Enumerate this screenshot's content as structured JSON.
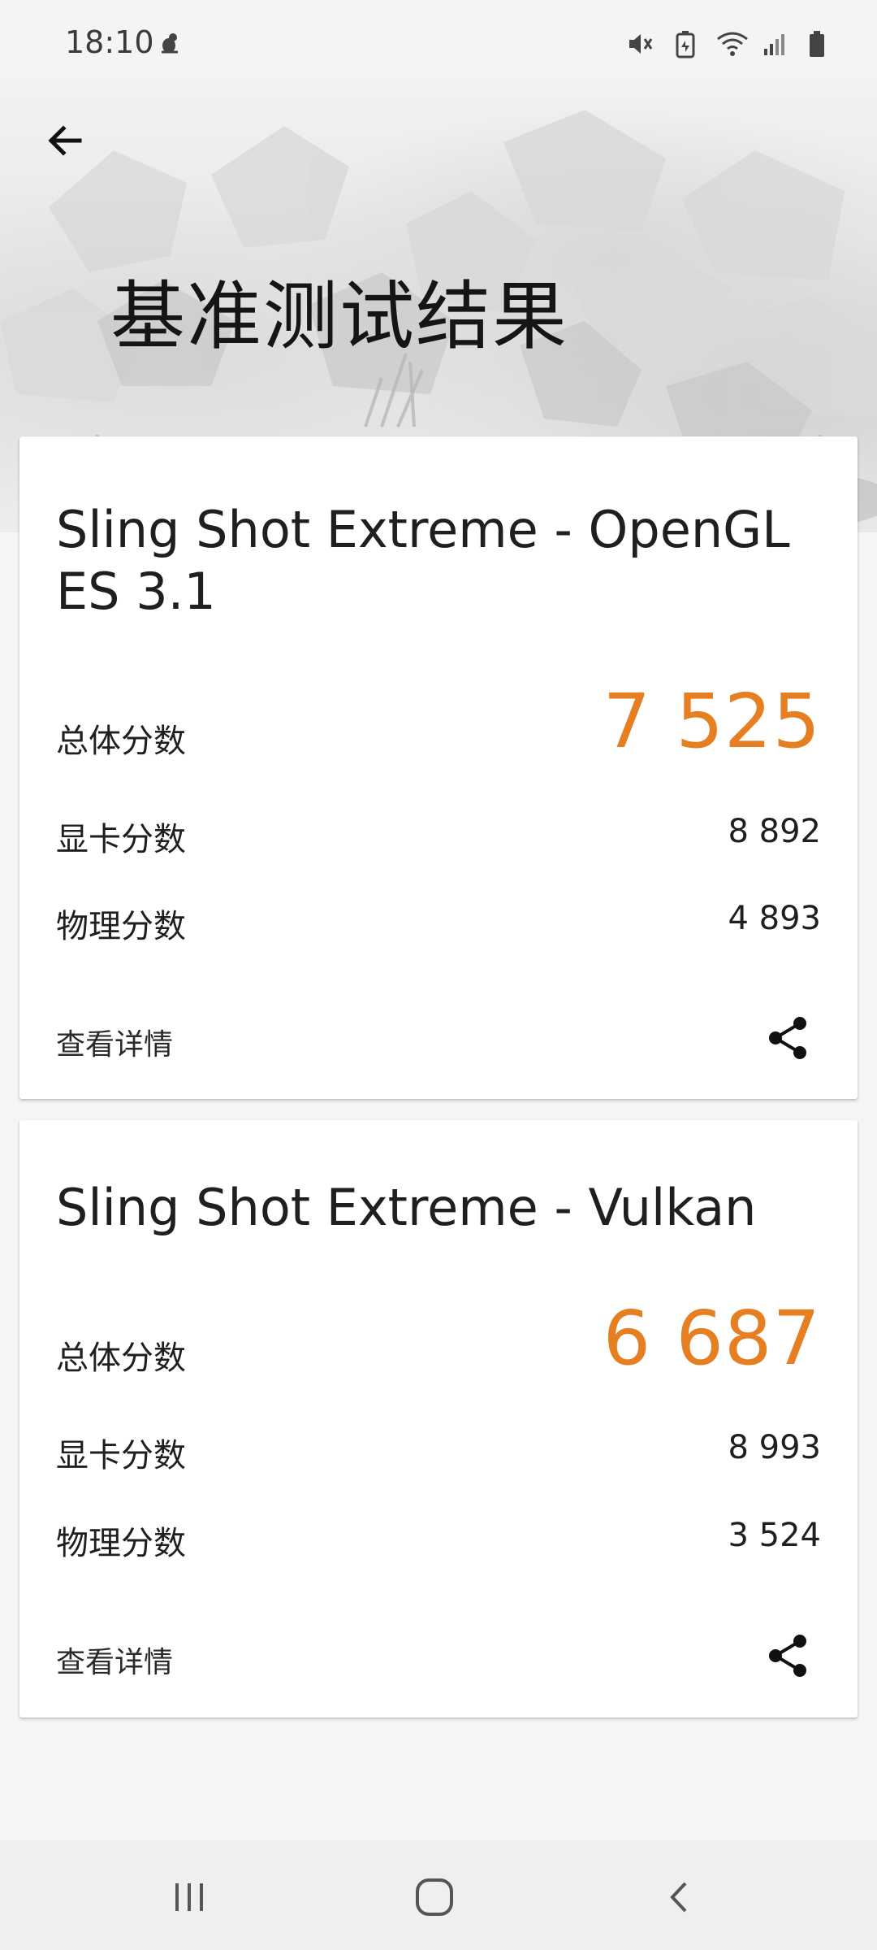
{
  "status_bar": {
    "time": "18:10",
    "icons": [
      "mute-icon",
      "battery-saver-icon",
      "wifi-icon",
      "signal-icon",
      "battery-icon"
    ]
  },
  "header": {
    "title": "基准测试结果",
    "back_icon": "arrow-left-icon"
  },
  "cards": [
    {
      "title": "Sling Shot Extreme - OpenGL ES 3.1",
      "overall_label": "总体分数",
      "overall_score": "7 525",
      "graphics_label": "显卡分数",
      "graphics_score": "8 892",
      "physics_label": "物理分数",
      "physics_score": "4 893",
      "details_label": "查看详情",
      "share_icon": "share-icon"
    },
    {
      "title": "Sling Shot Extreme - Vulkan",
      "overall_label": "总体分数",
      "overall_score": "6 687",
      "graphics_label": "显卡分数",
      "graphics_score": "8 993",
      "physics_label": "物理分数",
      "physics_score": "3 524",
      "details_label": "查看详情",
      "share_icon": "share-icon"
    }
  ],
  "nav_bar": {
    "recents_icon": "recents-icon",
    "home_icon": "home-icon",
    "back_icon": "back-chevron-icon"
  },
  "colors": {
    "accent": "#e67e22",
    "background": "#f5f5f5",
    "card": "#ffffff"
  }
}
